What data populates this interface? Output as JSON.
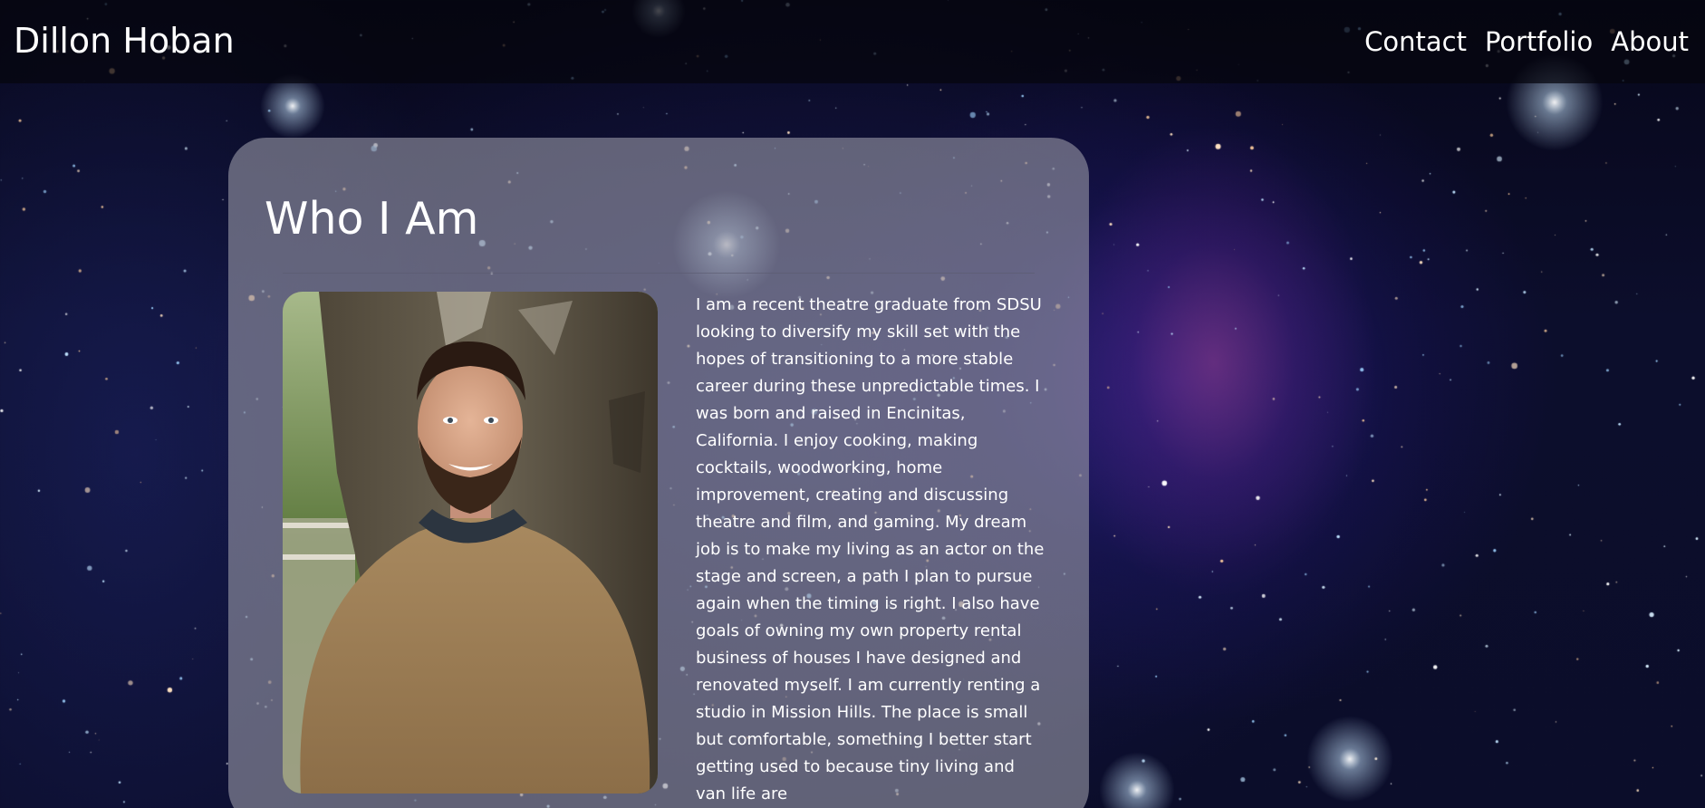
{
  "header": {
    "brand": "Dillon Hoban",
    "nav": [
      "Contact",
      "Portfolio",
      "About"
    ]
  },
  "about": {
    "heading": "Who I Am",
    "bio": "I am a recent theatre graduate from SDSU looking to diversify my skill set with the hopes of transitioning to a more stable career during these unpredictable times. I was born and raised in Encinitas, California. I enjoy cooking, making cocktails, woodworking, home improvement, creating and discussing theatre and film, and gaming. My dream job is to make my living as an actor on the stage and screen, a path I plan to pursue again when the timing is right. I also have goals of owning my own property rental business of houses I have designed and renovated myself. I am currently renting a studio in Mission Hills. The place is small but comfortable, something I better start getting used to because tiny living and van life are"
  },
  "colors": {
    "header_bg": "#05050e",
    "card_bg": "#9696a5",
    "text": "#ffffff"
  }
}
